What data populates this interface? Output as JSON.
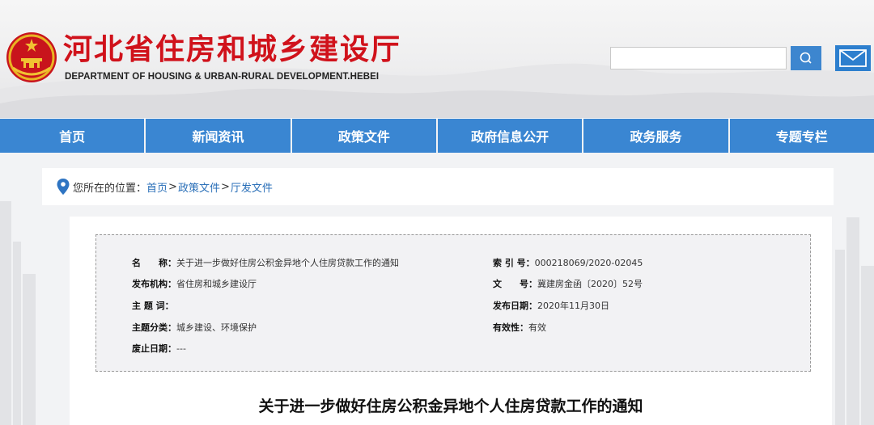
{
  "header": {
    "title": "河北省住房和城乡建设厅",
    "subtitle": "DEPARTMENT OF HOUSING & URBAN-RURAL DEVELOPMENT.HEBEI",
    "search_placeholder": "",
    "accent_color": "#3a86d2",
    "title_color": "#d0121b"
  },
  "nav": {
    "items": [
      {
        "label": "首页"
      },
      {
        "label": "新闻资讯"
      },
      {
        "label": "政策文件"
      },
      {
        "label": "政府信息公开"
      },
      {
        "label": "政务服务"
      },
      {
        "label": "专题专栏"
      }
    ]
  },
  "breadcrumb": {
    "prefix": "您所在的位置：",
    "items": [
      "首页",
      "政策文件",
      "厅发文件"
    ],
    "separator": ">"
  },
  "meta": {
    "name_key": "名　　称：",
    "name_val": "关于进一步做好住房公积金异地个人住房贷款工作的通知",
    "org_key": "发布机构：",
    "org_val": "省住房和城乡建设厅",
    "topic_key": "主 题 词：",
    "topic_val": "",
    "category_key": "主题分类：",
    "category_val": "城乡建设、环境保护",
    "expire_key": "废止日期：",
    "expire_val": "---",
    "index_key": "索 引 号：",
    "index_val": "000218069/2020-02045",
    "doc_key": "文　　号：",
    "doc_val": "冀建房金函〔2020〕52号",
    "date_key": "发布日期：",
    "date_val": "2020年11月30日",
    "valid_key": "有效性：",
    "valid_val": "有效"
  },
  "article": {
    "title": "关于进一步做好住房公积金异地个人住房贷款工作的通知"
  }
}
